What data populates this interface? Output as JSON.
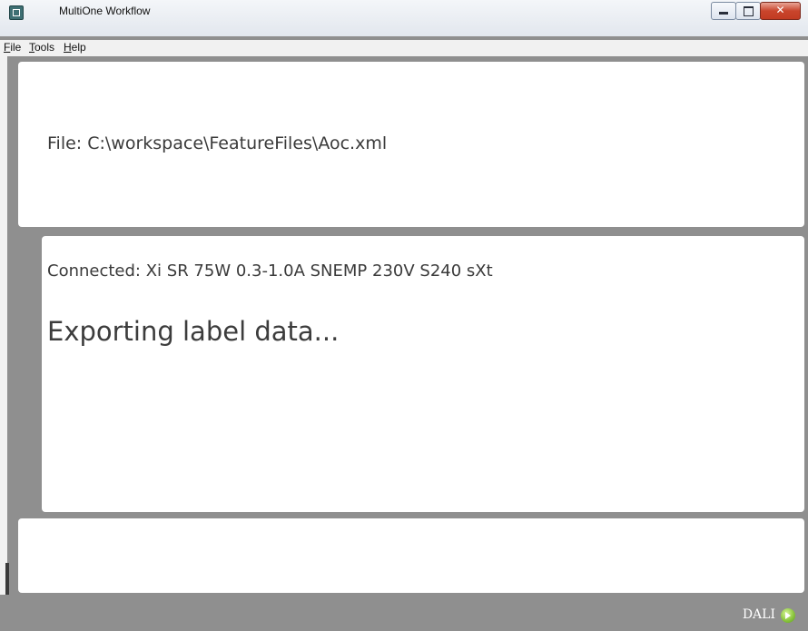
{
  "window": {
    "title": "MultiOne Workflow"
  },
  "menu": {
    "items": [
      {
        "label": "File",
        "accel": "F",
        "rest": "ile"
      },
      {
        "label": "Tools",
        "accel": "T",
        "rest": "ools"
      },
      {
        "label": "Help",
        "accel": "H",
        "rest": "elp"
      }
    ]
  },
  "file_panel": {
    "text": "File: C:\\workspace\\FeatureFiles\\Aoc.xml"
  },
  "status_panel": {
    "connected": "Connected: Xi SR 75W 0.3-1.0A SNEMP 230V S240 sXt",
    "progress": "Exporting label data..."
  },
  "statusbar": {
    "protocol": "DALI",
    "protocol_icon": "dali-connection-icon",
    "accent_color": "#8cc63f"
  },
  "colors": {
    "background": "#8f8f8f",
    "panel": "#ffffff",
    "close_button": "#c9452c"
  }
}
